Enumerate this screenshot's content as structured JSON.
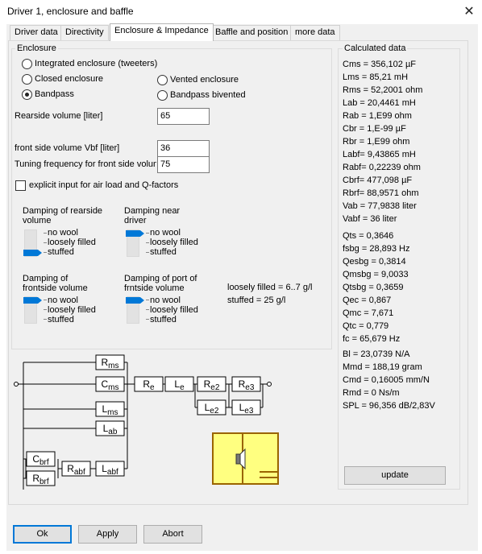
{
  "window": {
    "title": "Driver 1, enclosure and baffle",
    "close_glyph": "✕"
  },
  "tabs": [
    "Driver data",
    "Directivity",
    "Enclosure & Impedance",
    "Baffle and position",
    "more data"
  ],
  "enclosure": {
    "label": "Enclosure",
    "options": [
      "Integrated enclosure (tweeters)",
      "Closed enclosure",
      "Bandpass",
      "Vented enclosure",
      "Bandpass bivented"
    ],
    "selected": "Bandpass"
  },
  "fields": {
    "rear_label": "Rearside volume [liter]",
    "rear_value": "65",
    "front_label": "front side volume Vbf [liter]",
    "front_value": "36",
    "tuning_label": "Tuning frequency for front side volume",
    "tuning_value": "75"
  },
  "explicit_label": "explicit input for air load and Q-factors",
  "damping": {
    "rear_label": "Damping of rearside volume",
    "near_label": "Damping near driver",
    "front_label": "Damping of frontside volume",
    "port_label": "Damping of port of frntside volume",
    "levels": [
      "no wool",
      "loosely filled",
      "stuffed"
    ],
    "rear_level": "stuffed",
    "near_level": "no wool",
    "front_level": "no wool",
    "port_level": "no wool",
    "note_loose": "loosely filled = 6..7 g/l",
    "note_stuffed": "stuffed = 25 g/l"
  },
  "circuit": {
    "Rms": [
      "R",
      "ms"
    ],
    "Cms": [
      "C",
      "ms"
    ],
    "Lms": [
      "L",
      "ms"
    ],
    "Lab": [
      "L",
      "ab"
    ],
    "Re": [
      "R",
      "e"
    ],
    "Le": [
      "L",
      "e"
    ],
    "Re2": [
      "R",
      "e2"
    ],
    "Re3": [
      "R",
      "e3"
    ],
    "Le2": [
      "L",
      "e2"
    ],
    "Le3": [
      "L",
      "e3"
    ],
    "Cbrf": [
      "C",
      "brf"
    ],
    "Rbrf": [
      "R",
      "brf"
    ],
    "Rabf": [
      "R",
      "abf"
    ],
    "Labf": [
      "L",
      "abf"
    ]
  },
  "calculated": {
    "label": "Calculated data",
    "group1": [
      "Cms = 356,102 µF",
      "Lms = 85,21 mH",
      "Rms = 52,2001 ohm",
      "Lab = 20,4461 mH",
      "Rab = 1,E99 ohm",
      "Cbr = 1,E-99 µF",
      "Rbr = 1,E99 ohm",
      "Labf= 9,43865 mH",
      "Rabf= 0,22239 ohm",
      "Cbrf= 477,098 µF",
      "Rbrf= 88,9571 ohm",
      "Vab = 77,9838 liter",
      "Vabf = 36 liter"
    ],
    "group2": [
      "Qts = 0,3646",
      "fsbg = 28,893 Hz",
      "Qesbg = 0,3814",
      "Qmsbg = 9,0033",
      "Qtsbg = 0,3659",
      "Qec = 0,867",
      "Qmc = 7,671",
      "Qtc = 0,779",
      "fc  = 65,679 Hz"
    ],
    "group3": [
      "Bl = 23,0739 N/A",
      "Mmd = 188,19 gram",
      "Cmd = 0,16005 mm/N",
      "Rmd = 0 Ns/m",
      "SPL = 96,356 dB/2,83V"
    ],
    "update_label": "update"
  },
  "buttons": {
    "ok": "Ok",
    "apply": "Apply",
    "abort": "Abort"
  },
  "colors": {
    "accent": "#0078d7",
    "speaker_fill": "#ffff80",
    "speaker_border": "#9a6400"
  }
}
